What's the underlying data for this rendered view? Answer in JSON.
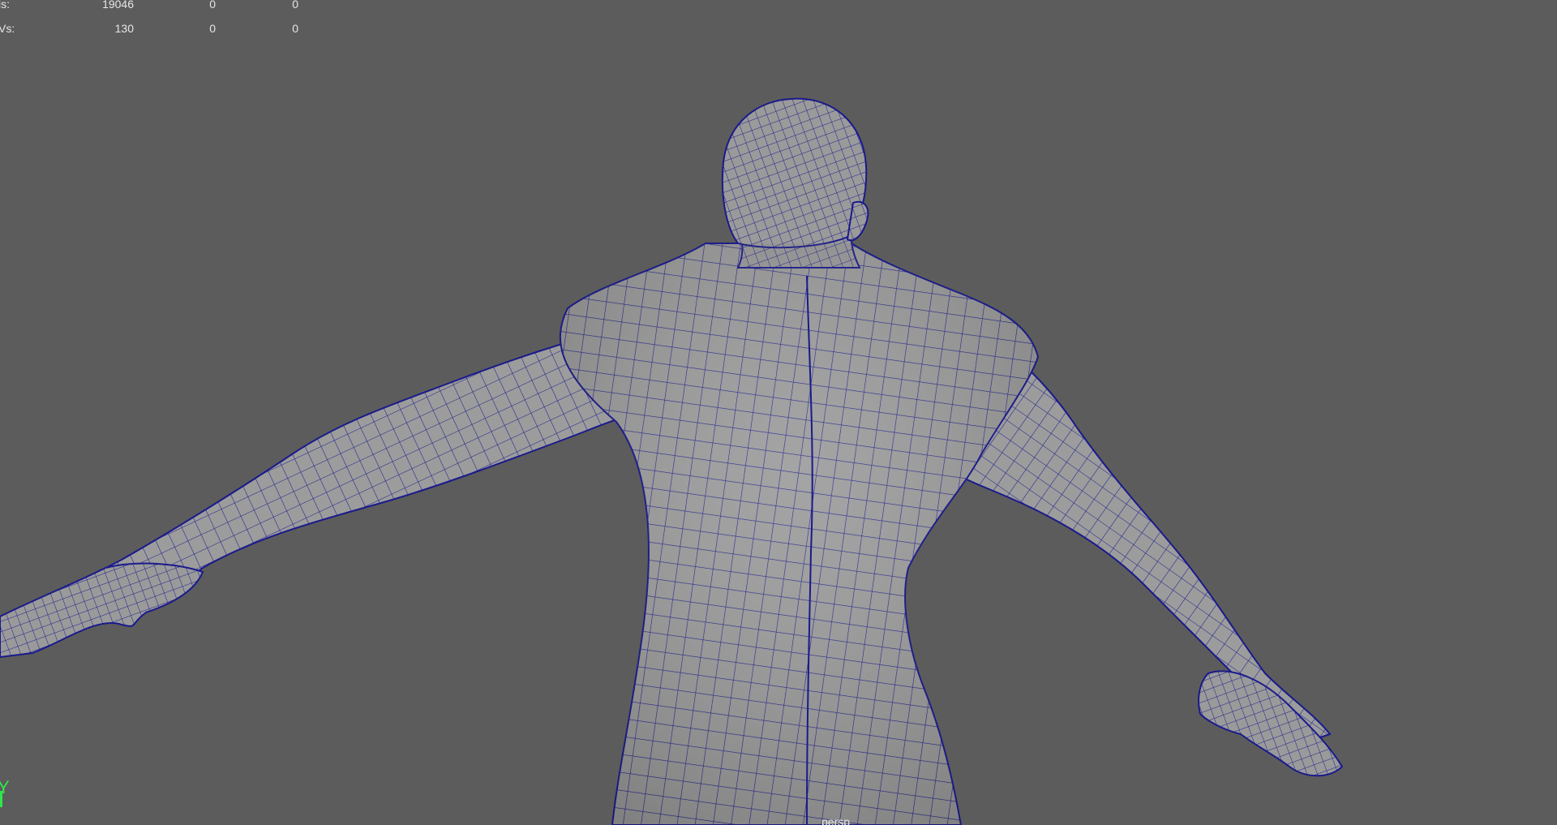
{
  "hud": {
    "rows": [
      {
        "label": "is:",
        "c1": "19046",
        "c2": "0",
        "c3": "0"
      },
      {
        "label": "Vs:",
        "c1": "130",
        "c2": "0",
        "c3": "0"
      }
    ]
  },
  "axis": {
    "y_label": "Y",
    "y_color": "#2ee84a"
  },
  "camera": {
    "name": "persp"
  },
  "colors": {
    "background": "#5c5c5c",
    "mesh_fill": "#9c9c9c",
    "wireframe": "#1a1a8c"
  }
}
